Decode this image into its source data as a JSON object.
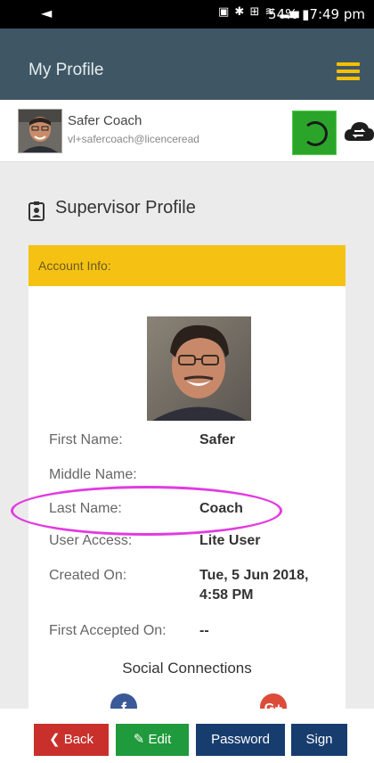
{
  "status_bar": {
    "back_glyph": "◄",
    "icons": [
      "nfc-icon",
      "bluetooth-icon",
      "volte-icon",
      "wifi-icon",
      "signal-icon"
    ],
    "icons_text": "▣ ✱ ⊞ ≋ ▂▄",
    "battery": "54%",
    "time": "7:49 pm",
    "display": "54% ▮7:49 pm"
  },
  "app_bar": {
    "title": "My Profile",
    "menu_icon": "hamburger-icon",
    "accent": "#f5c000"
  },
  "user_bar": {
    "name": "Safer Coach",
    "email": "vl+safercoach@licenceread",
    "sync_icon": "spinner-icon",
    "cloud_icon": "cloud-sync-icon"
  },
  "section": {
    "icon": "id-badge-icon",
    "title": "Supervisor Profile"
  },
  "card": {
    "header": "Account Info:",
    "header_color": "#f5c214",
    "fields": [
      {
        "label": "First Name:",
        "value": "Safer"
      },
      {
        "label": "Middle Name:",
        "value": ""
      },
      {
        "label": "Last Name:",
        "value": "Coach"
      },
      {
        "label": "User Access:",
        "value": "Lite User"
      },
      {
        "label": "Created On:",
        "value": "Tue, 5 Jun 2018, 4:58 PM"
      },
      {
        "label": "First Accepted On:",
        "value": "--"
      }
    ],
    "social_title": "Social Connections",
    "social": [
      "facebook-icon",
      "google-plus-icon"
    ],
    "fb_glyph": "f",
    "gp_glyph": "G+"
  },
  "buttons": {
    "back": "❮ Back",
    "edit": "✎ Edit",
    "password": "Password",
    "sign": "Sign"
  },
  "colors": {
    "app_bar": "#3f5765",
    "back": "#c9302c",
    "edit": "#1f9a3c",
    "primary": "#173d6e",
    "highlight": "#e23be0"
  }
}
